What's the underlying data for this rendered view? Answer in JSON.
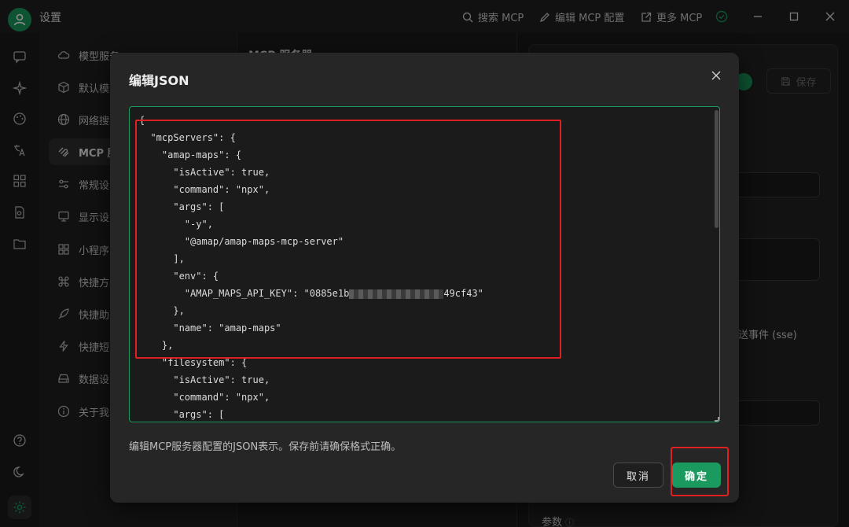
{
  "app": {
    "title": "设置"
  },
  "titlebar": {
    "search_mcp": "搜索 MCP",
    "edit_mcp_config": "编辑 MCP 配置",
    "more_mcp": "更多 MCP"
  },
  "menu": {
    "items": [
      {
        "label": "模型服务",
        "icon": "cloud-icon"
      },
      {
        "label": "默认模",
        "icon": "cube-icon"
      },
      {
        "label": "网络搜",
        "icon": "globe-icon"
      },
      {
        "label": "MCP 服",
        "icon": "mcp-icon"
      },
      {
        "label": "常规设",
        "icon": "sliders-icon"
      },
      {
        "label": "显示设",
        "icon": "monitor-icon"
      },
      {
        "label": "小程序",
        "icon": "grid-icon"
      },
      {
        "label": "快捷方",
        "icon": "command-icon"
      },
      {
        "label": "快捷助",
        "icon": "rocket-icon"
      },
      {
        "label": "快捷短",
        "icon": "bolt-icon"
      },
      {
        "label": "数据设",
        "icon": "drive-icon"
      },
      {
        "label": "关于我",
        "icon": "info-icon"
      }
    ]
  },
  "server_col": {
    "title": "MCP 服务器"
  },
  "detail": {
    "save_label": "保存",
    "transport_text": "送事件 (sse)",
    "params_label": "参数"
  },
  "modal": {
    "title": "编辑JSON",
    "code_lines": [
      "{",
      "  \"mcpServers\": {",
      "    \"amap-maps\": {",
      "      \"isActive\": true,",
      "      \"command\": \"npx\",",
      "      \"args\": [",
      "        \"-y\",",
      "        \"@amap/amap-maps-mcp-server\"",
      "      ],",
      "      \"env\": {",
      "        \"AMAP_MAPS_API_KEY\": \"0885e1b",
      "      },",
      "      \"name\": \"amap-maps\"",
      "    },",
      "    \"filesystem\": {",
      "      \"isActive\": true,",
      "      \"command\": \"npx\",",
      "      \"args\": ["
    ],
    "api_key_tail": "49cf43\"",
    "hint": "编辑MCP服务器配置的JSON表示。保存前请确保格式正确。",
    "cancel_label": "取消",
    "ok_label": "确定"
  },
  "colors": {
    "accent": "#1a9a5e",
    "annotation": "#e02020"
  }
}
